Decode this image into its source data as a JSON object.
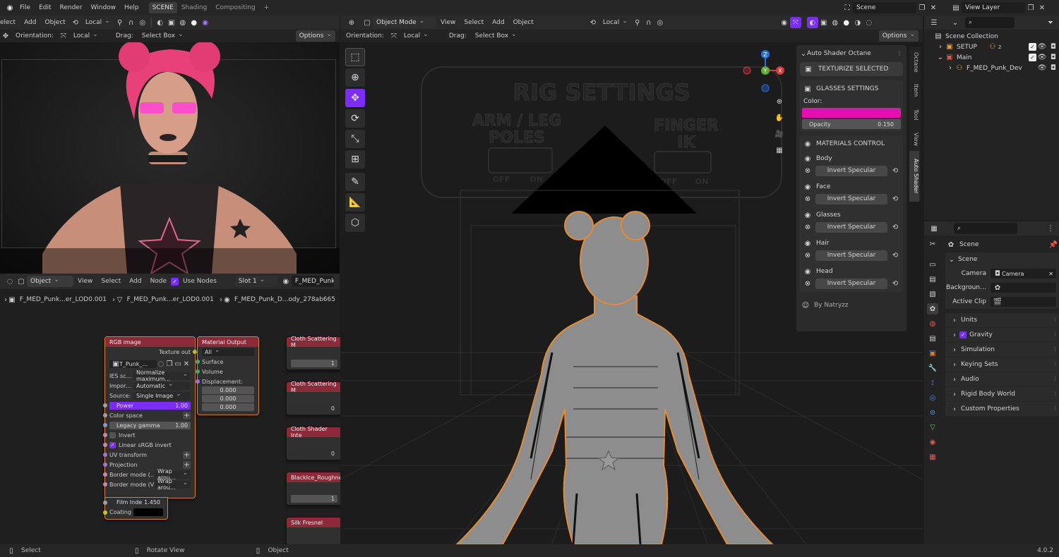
{
  "menu": {
    "file": "File",
    "edit": "Edit",
    "render": "Render",
    "window": "Window",
    "help": "Help"
  },
  "workspaces": [
    {
      "label": "SCENE"
    },
    {
      "label": "Shading"
    },
    {
      "label": "Compositing"
    }
  ],
  "add_workspace": "+",
  "scene_name": "Scene",
  "view_layer": "View Layer",
  "left_header": {
    "select": "elect",
    "add": "Add",
    "object": "Object",
    "transform": "Local",
    "orientation_label": "Orientation:",
    "orientation": "Local",
    "drag_label": "Drag:",
    "drag": "Select Box",
    "options": "Options"
  },
  "viewport_header": {
    "mode": "Object Mode",
    "view": "View",
    "select": "Select",
    "add": "Add",
    "object": "Object",
    "transform": "Local",
    "orientation_label": "Orientation:",
    "orientation": "Local",
    "drag_label": "Drag:",
    "drag": "Select Box",
    "options": "Options"
  },
  "rig_text": {
    "title": "RIG SETTINGS",
    "left": "ARM / LEG",
    "left2": "POLES",
    "right": "FINGER",
    "right2": "IK",
    "off": "OFF",
    "on": "ON"
  },
  "gizmo": {
    "z": "Z",
    "y": "Y",
    "x": "X"
  },
  "npanel": {
    "title": "Auto Shader Octane",
    "texturize": "TEXTURIZE SELECTED",
    "glasses_title": "GLASSES SETTINGS",
    "color_label": "Color:",
    "color": "#e30fb0",
    "opacity_label": "Opacity",
    "opacity": "0.150",
    "materials_title": "MATERIALS CONTROL",
    "materials": [
      {
        "name": "Body",
        "button": "Invert Specular"
      },
      {
        "name": "Face",
        "button": "Invert Specular"
      },
      {
        "name": "Glasses",
        "button": "Invert Specular"
      },
      {
        "name": "Hair",
        "button": "Invert Specular"
      },
      {
        "name": "Head",
        "button": "Invert Specular"
      }
    ],
    "footer": "By Natryzz"
  },
  "side_tabs": [
    {
      "label": "Octane"
    },
    {
      "label": "Item"
    },
    {
      "label": "Tool"
    },
    {
      "label": "View"
    },
    {
      "label": "Auto Shader"
    }
  ],
  "outliner": {
    "search_placeholder": "",
    "rows": [
      {
        "label": "Scene Collection"
      },
      {
        "label": "SETUP",
        "badge": "2"
      },
      {
        "label": "Main"
      },
      {
        "label": "F_MED_Punk_Dev"
      }
    ]
  },
  "properties": {
    "header": "Scene",
    "section": "Scene",
    "camera_label": "Camera",
    "camera": "Camera",
    "background_label": "Backgroun…",
    "clip_label": "Active Clip",
    "panels": [
      {
        "label": "Units"
      },
      {
        "label": "Gravity"
      },
      {
        "label": "Simulation"
      },
      {
        "label": "Keying Sets"
      },
      {
        "label": "Audio"
      },
      {
        "label": "Rigid Body World"
      },
      {
        "label": "Custom Properties"
      }
    ]
  },
  "node_header": {
    "object": "Object",
    "view": "View",
    "select": "Select",
    "add": "Add",
    "node": "Node",
    "use_nodes": "Use Nodes",
    "slot": "Slot 1",
    "material": "F_MED_Punk_I"
  },
  "breadcrumb": [
    {
      "label": "F_MED_Punk...er_LOD0.001"
    },
    {
      "label": "F_MED_Punk...er_LOD0.001"
    },
    {
      "label": "F_MED_Punk_D...ody_278ab665"
    }
  ],
  "rgb_node": {
    "title": "RGB image",
    "texture_out": "Texture out",
    "image": "T_Punk_…",
    "ies_label": "IES sc…",
    "ies": "Normalize maximum…",
    "import_label": "Impor…",
    "import": "Automatic",
    "source_label": "Source:",
    "source": "Single Image",
    "power_label": "Power",
    "power": "1.00",
    "color_space": "Color space",
    "legacy_label": "Legacy gamma",
    "legacy": "1.00",
    "invert": "Invert",
    "linear": "Linear sRGB invert",
    "uv": "UV transform",
    "projection": "Projection",
    "border_u_label": "Border mode (…",
    "border_u": "Wrap arou…",
    "border_v_label": "Border mode (V)",
    "border_v": "Wrap arou…"
  },
  "output_node": {
    "title": "Material Output",
    "target": "All",
    "surface": "Surface",
    "volume": "Volume",
    "displacement": "Displacement:",
    "values": [
      "0.000",
      "0.000",
      "0.000"
    ]
  },
  "film_node": {
    "film_label": "Film Inde",
    "film": "1.450",
    "coating": "Coating"
  },
  "side_nodes": [
    {
      "title": "Cloth Scattering M",
      "value": "1"
    },
    {
      "title": "Cloth Scattering M",
      "value": "0"
    },
    {
      "title": "Cloth Shader Inte",
      "value": "0"
    },
    {
      "title": "BlackIce_Roughne",
      "value": "1"
    },
    {
      "title": "Silk Fresnel"
    }
  ],
  "status": {
    "select": "Select",
    "rotate": "Rotate View",
    "object": "Object",
    "version": "4.0.2"
  },
  "colors": {
    "accent": "#7b2df5",
    "node_header": "#8c2a3a",
    "selection": "#e07b2f"
  }
}
